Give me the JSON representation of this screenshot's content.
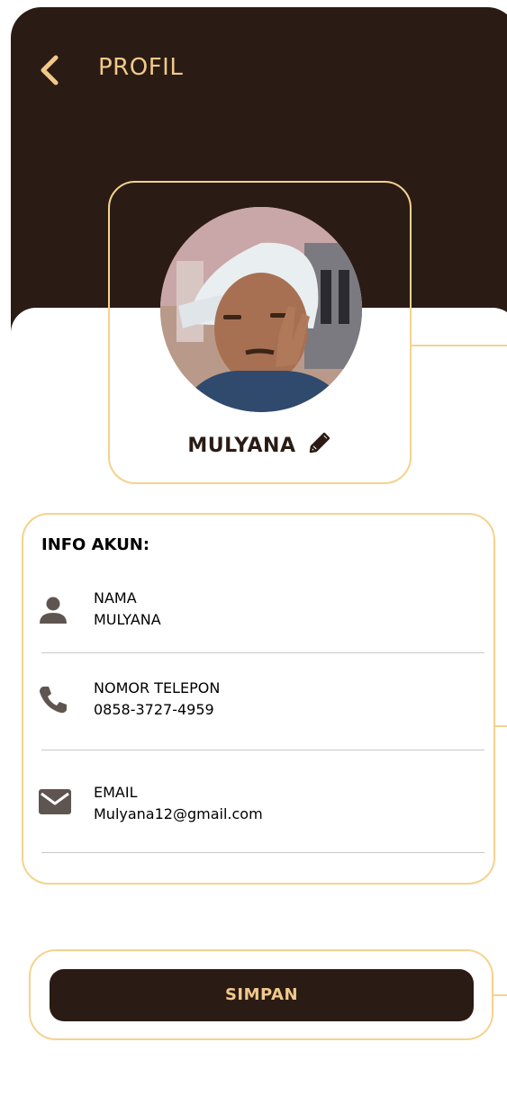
{
  "header": {
    "title": "PROFIL",
    "back_icon": "chevron-left-icon"
  },
  "profile": {
    "name": "MULYANA",
    "avatar": "profile-photo",
    "edit_icon": "pencil-icon"
  },
  "info": {
    "heading": "INFO AKUN:",
    "rows": [
      {
        "icon": "person-icon",
        "label": "NAMA",
        "value": "MULYANA"
      },
      {
        "icon": "phone-icon",
        "label": "NOMOR TELEPON",
        "value": "0858-3727-4959"
      },
      {
        "icon": "mail-icon",
        "label": "EMAIL",
        "value": "Mulyana12@gmail.com"
      }
    ]
  },
  "actions": {
    "save_label": "SIMPAN"
  },
  "colors": {
    "header_bg": "#2a1b14",
    "accent_gold": "#f0c98a",
    "outline": "#f5d28e",
    "icon_gray": "#5f5550",
    "divider": "#c8c8c8"
  }
}
